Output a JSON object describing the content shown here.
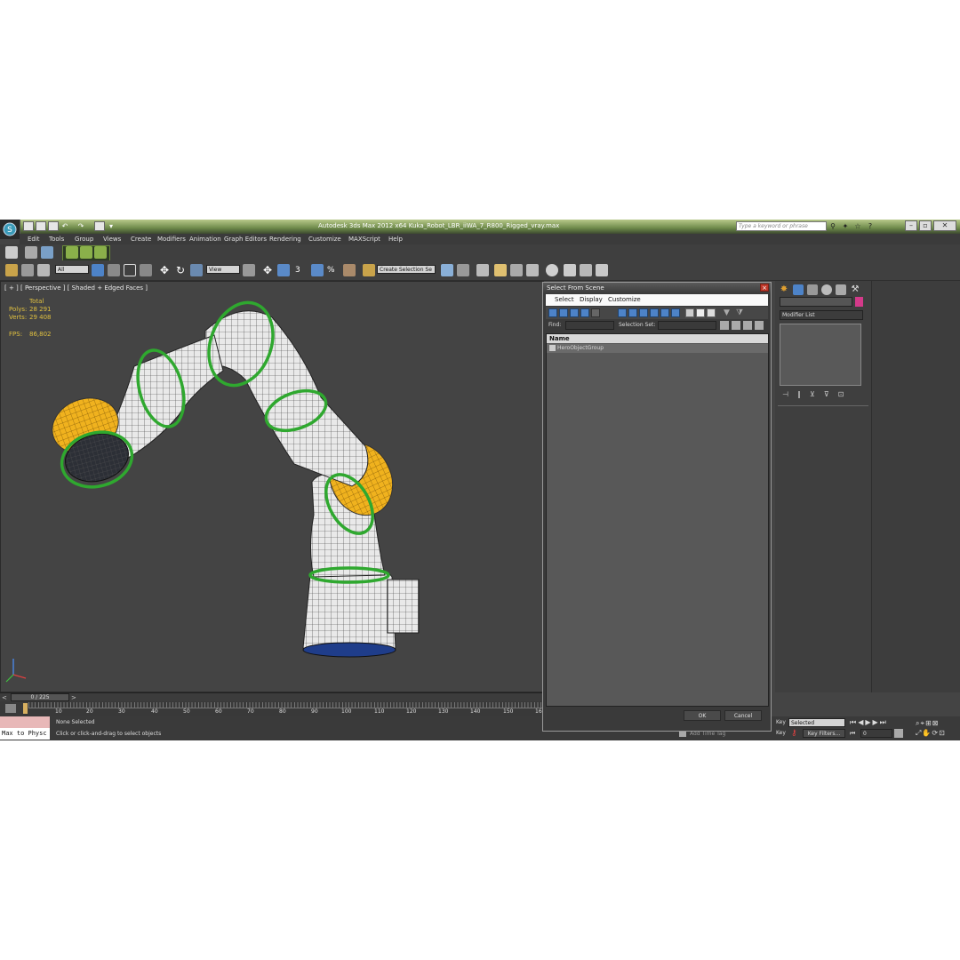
{
  "app": {
    "title": "Autodesk 3ds Max 2012 x64     Kuka_Robot_LBR_iiWA_7_R800_Rigged_vray.max",
    "search_placeholder": "Type a keyword or phrase"
  },
  "menu": [
    "Edit",
    "Tools",
    "Group",
    "Views",
    "Create",
    "Modifiers",
    "Animation",
    "Graph Editors",
    "Rendering",
    "Customize",
    "MAXScript",
    "Help"
  ],
  "toolbar": {
    "selection_filter": "All",
    "reference_coord": "View",
    "named_selection": "Create Selection Se"
  },
  "viewport": {
    "label": "[ + ] [ Perspective ] [ Shaded + Edged Faces ]",
    "stats": {
      "total_label": "Total",
      "polys_label": "Polys:",
      "polys_value": "28 291",
      "verts_label": "Verts:",
      "verts_value": "29 408",
      "fps_label": "FPS:",
      "fps_value": "86,802"
    },
    "axis_x": "x",
    "axis_y": "y",
    "axis_z": "z"
  },
  "dialog": {
    "title": "Select From Scene",
    "close": "×",
    "menus": [
      "Select",
      "Display",
      "Customize"
    ],
    "find_label": "Find:",
    "selection_set_label": "Selection Set:",
    "list_header": "Name",
    "items": [
      "HeroObjectGroup"
    ],
    "ok_label": "OK",
    "cancel_label": "Cancel"
  },
  "command_panel": {
    "modifier_list": "Modifier List"
  },
  "timeline": {
    "frame_readout": "0 / 225",
    "ticks": [
      "10",
      "20",
      "30",
      "40",
      "50",
      "60",
      "70",
      "80",
      "90",
      "100",
      "110",
      "120",
      "130",
      "140",
      "150",
      "16"
    ]
  },
  "status": {
    "maxscript": "Max to Physc",
    "selection": "None Selected",
    "prompt": "Click or click-and-drag to select objects",
    "add_time_tag": "Add Time Tag",
    "key_label": "Key",
    "selected_dropdown": "Selected",
    "key_filters": "Key Filters...",
    "frame_value": "0",
    "key_label2": "Key"
  },
  "colors": {
    "accent_green": "#2fa82f",
    "accent_yellow": "#e8a914",
    "viewport_bg": "#444444"
  }
}
